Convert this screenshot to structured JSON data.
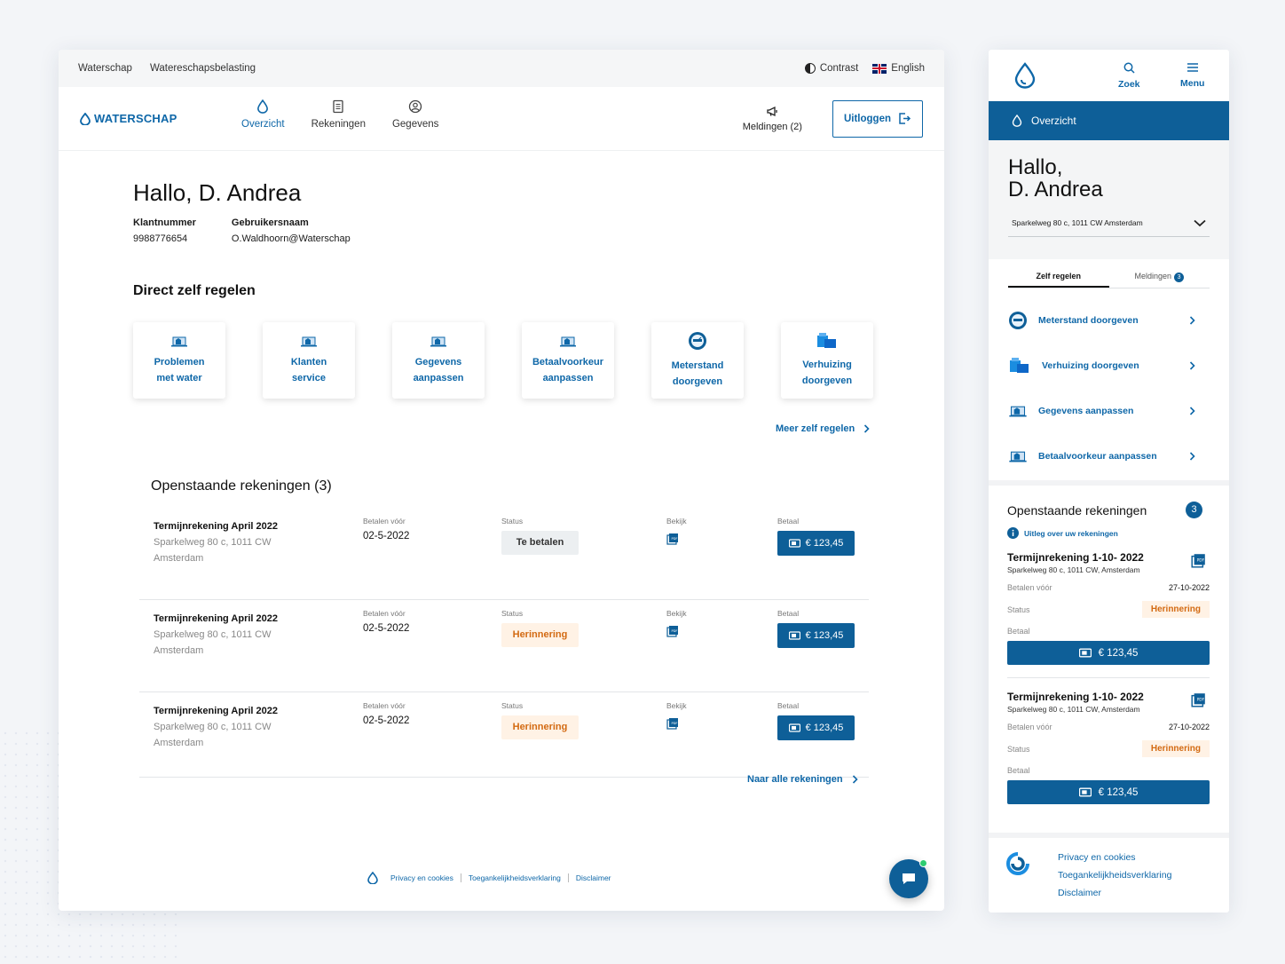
{
  "desktop": {
    "topbar": {
      "links": [
        "Waterschap",
        "Watereschapsbelasting"
      ],
      "contrast": "Contrast",
      "language": "English"
    },
    "brand": "WATERSCHAP",
    "nav": [
      {
        "label": "Overzicht",
        "icon": "drop-icon"
      },
      {
        "label": "Rekeningen",
        "icon": "document-icon"
      },
      {
        "label": "Gegevens",
        "icon": "user-icon"
      }
    ],
    "notifications": "Meldingen (2)",
    "logout": "Uitloggen",
    "greeting": "Hallo, D. Andrea",
    "customer": {
      "number_label": "Klantnummer",
      "number": "9988776654",
      "user_label": "Gebruikersnaam",
      "user": "O.Waldhoorn@Waterschap"
    },
    "self_service_title": "Direct zelf regelen",
    "tiles": [
      {
        "line1": "Problemen",
        "line2": "met water",
        "icon": "house-icon"
      },
      {
        "line1": "Klanten",
        "line2": "service",
        "icon": "house-icon"
      },
      {
        "line1": "Gegevens",
        "line2": "aanpassen",
        "icon": "house-icon"
      },
      {
        "line1": "Betaalvoorkeur",
        "line2": "aanpassen",
        "icon": "house-icon"
      },
      {
        "line1": "Meterstand",
        "line2": "doorgeven",
        "icon": "meter-icon"
      },
      {
        "line1": "Verhuizing",
        "line2": "doorgeven",
        "icon": "moving-box-icon"
      }
    ],
    "more_link": "Meer zelf regelen",
    "invoices_title": "Openstaande rekeningen (3)",
    "col_labels": {
      "due": "Betalen vóór",
      "status": "Status",
      "view": "Bekijk",
      "pay": "Betaal"
    },
    "invoices": [
      {
        "name": "Termijnrekening April 2022",
        "addr1": "Sparkelweg 80 c,  1011 CW",
        "addr2": "Amsterdam",
        "due": "02-5-2022",
        "status": "Te betalen",
        "amount": "€ 123,45"
      },
      {
        "name": "Termijnrekening April 2022",
        "addr1": "Sparkelweg 80 c,  1011 CW",
        "addr2": "Amsterdam",
        "due": "02-5-2022",
        "status": "Herinnering",
        "amount": "€ 123,45"
      },
      {
        "name": "Termijnrekening April 2022",
        "addr1": "Sparkelweg 80 c,  1011 CW",
        "addr2": "Amsterdam",
        "due": "02-5-2022",
        "status": "Herinnering",
        "amount": "€ 123,45"
      }
    ],
    "all_invoices_link": "Naar alle rekeningen",
    "footer": [
      "Privacy en cookies",
      "Toegankelijkheidsverklaring",
      "Disclaimer"
    ]
  },
  "mobile": {
    "search": "Zoek",
    "menu": "Menu",
    "active_section": "Overzicht",
    "greeting_line1": "Hallo,",
    "greeting_line2": "D. Andrea",
    "address": "Sparkelweg 80 c,  1011 CW Amsterdam",
    "tabs": {
      "self": "Zelf regelen",
      "notifications": "Meldingen",
      "notifications_count": "3"
    },
    "actions": [
      {
        "label": "Meterstand doorgeven",
        "icon": "meter-icon"
      },
      {
        "label": "Verhuizing doorgeven",
        "icon": "moving-box-icon"
      },
      {
        "label": "Gegevens aanpassen",
        "icon": "house-icon"
      },
      {
        "label": "Betaalvoorkeur aanpassen",
        "icon": "house-icon"
      }
    ],
    "invoices_title": "Openstaande rekeningen",
    "invoices_count": "3",
    "explain_link": "Uitleg over uw rekeningen",
    "labels": {
      "due": "Betalen vóór",
      "status": "Status",
      "pay": "Betaal"
    },
    "invoices": [
      {
        "name": "Termijnrekening  1-10- 2022",
        "addr": "Sparkelweg 80 c, 1011 CW,  Amsterdam",
        "due": "27-10-2022",
        "status": "Herinnering",
        "amount": "€ 123,45"
      },
      {
        "name": "Termijnrekening  1-10- 2022",
        "addr": "Sparkelweg 80 c, 1011 CW,  Amsterdam",
        "due": "27-10-2022",
        "status": "Herinnering",
        "amount": "€ 123,45"
      }
    ],
    "footer": [
      "Privacy en cookies",
      "Toegankelijkheidsverklaring",
      "Disclaimer"
    ]
  },
  "colors": {
    "primary": "#0e5f98",
    "link": "#0e67a8",
    "warning_bg": "#fff2e5",
    "warning_text": "#d36a12"
  }
}
